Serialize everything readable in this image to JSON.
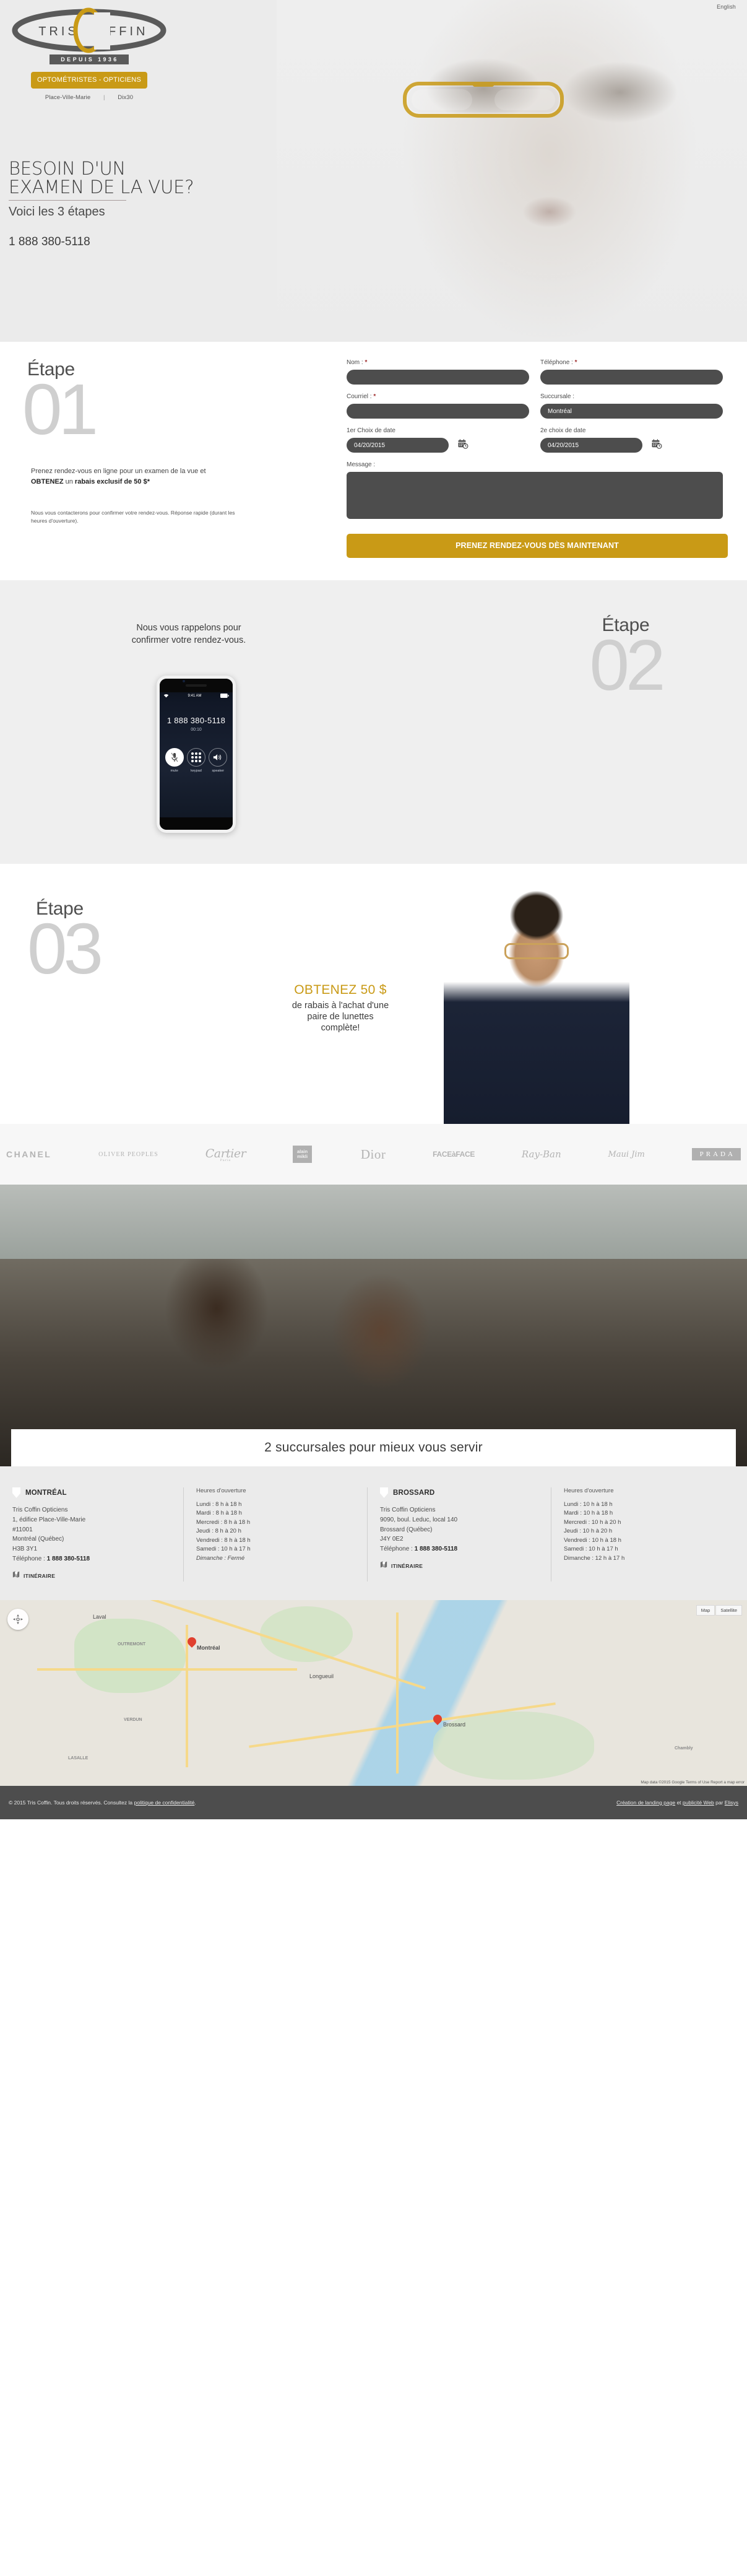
{
  "header": {
    "lang_label": "English",
    "logo": {
      "word_left": "TRIS",
      "word_right": "OFFIN",
      "middle_letter": "C"
    },
    "tagline": "DEPUIS 1936",
    "optom_button": "OPTOMÉTRISTES - OPTICIENS",
    "places": {
      "first": "Place-Ville-Marie",
      "separator": "|",
      "second": "Dix30"
    }
  },
  "hero": {
    "title_line1": "BESOIN D'UN",
    "title_line2": "EXAMEN DE LA VUE?",
    "subtitle": "Voici les 3 étapes",
    "phone": "1 888 380-5118"
  },
  "step1": {
    "word": "Étape",
    "number": "01",
    "blurb_pre": "Prenez rendez-vous en ligne pour un examen de la vue et ",
    "blurb_bold1": "OBTENEZ",
    "blurb_mid": " un ",
    "blurb_bold2": "rabais exclusif de 50 $*",
    "note": "Nous vous contacterons pour confirmer votre rendez-vous. Réponse rapide (durant les heures d'ouverture).",
    "form": {
      "nom_label": "Nom :",
      "nom_value": "",
      "telephone_label": "Téléphone :",
      "telephone_value": "",
      "courriel_label": "Courriel :",
      "courriel_value": "",
      "succursale_label": "Succursale :",
      "succursale_value": "Montréal",
      "date1_label": "1er Choix de date",
      "date1_sup": "er",
      "date1_value": "04/20/2015",
      "date2_label": "2e choix de date",
      "date2_sup": "e",
      "date2_value": "04/20/2015",
      "message_label": "Message :",
      "message_value": "",
      "required_mark": "*",
      "submit_label": "PRENEZ RENDEZ-VOUS DÈS MAINTENANT"
    }
  },
  "step2": {
    "word": "Étape",
    "number": "02",
    "copy_line1": "Nous vous rappelons pour",
    "copy_line2": "confirmer votre rendez-vous.",
    "phone_ui": {
      "status_time": "9:41 AM",
      "number": "1 888 380-5118",
      "timer": "00:10",
      "buttons": [
        "mute",
        "keypad",
        "speaker"
      ]
    }
  },
  "step3": {
    "word": "Étape",
    "number": "03",
    "offer_title": "OBTENEZ 50 $",
    "offer_line1": "de rabais à l'achat d'une",
    "offer_line2": "paire de lunettes",
    "offer_line3": "complète!"
  },
  "brands": [
    {
      "name": "CHANEL",
      "style": "chanel"
    },
    {
      "name": "OLIVER PEOPLES",
      "style": "oliver"
    },
    {
      "name": "Cartier",
      "sub": "Paris",
      "style": "cartier"
    },
    {
      "name": "alain mikli",
      "style": "alain"
    },
    {
      "name": "Dior",
      "style": "dior"
    },
    {
      "name": "FACEàFACE",
      "style": "f2f"
    },
    {
      "name": "Ray-Ban",
      "style": "rayban"
    },
    {
      "name": "Maui Jim",
      "style": "maui"
    },
    {
      "name": "PRADA",
      "style": "prada"
    }
  ],
  "branches_banner": {
    "title": "2 succursales pour mieux vous servir"
  },
  "locations": [
    {
      "name": "MONTRÉAL",
      "company": "Tris Coffin Opticiens",
      "address1": "1, édifice Place-Ville-Marie",
      "address2": "#11001",
      "city": "Montréal (Québec)",
      "postal": "H3B 3Y1",
      "phone_label": "Téléphone : ",
      "phone": "1 888 380-5118",
      "itineraire": "ITINÉRAIRE",
      "hours_title": "Heures d'ouverture",
      "hours": [
        "Lundi : 8 h à 18 h",
        "Mardi : 8 h à 18 h",
        "Mercredi : 8 h à 18 h",
        "Jeudi :  8 h à 20 h",
        "Vendredi : 8 h à 18 h",
        "Samedi : 10 h à 17 h"
      ],
      "hours_closed": "Dimanche : Fermé"
    },
    {
      "name": "BROSSARD",
      "company": "Tris Coffin Opticiens",
      "address1": "9090, boul. Leduc, local 140",
      "address2": "",
      "city": "Brossard (Québec)",
      "postal": "J4Y 0E2",
      "phone_label": "Téléphone : ",
      "phone": "1 888 380-5118",
      "itineraire": "ITINÉRAIRE",
      "hours_title": "Heures d'ouverture",
      "hours": [
        "Lundi : 10 h à 18 h",
        "Mardi : 10 h à 18 h",
        "Mercredi : 10 h à 20 h",
        "Jeudi :  10 h à 20 h",
        "Vendredi : 10 h à 18 h",
        "Samedi : 10 h à 17 h",
        "Dimanche : 12 h à 17 h"
      ],
      "hours_closed": ""
    }
  ],
  "map": {
    "buttons": [
      "Map",
      "Satellite"
    ],
    "labels": [
      "Montréal",
      "Brossard",
      "Longueuil",
      "Laval",
      "OUTREMONT",
      "VERDUN",
      "LASALLE",
      "Chambly"
    ],
    "attribution": "Map data ©2015 Google   Terms of Use   Report a map error"
  },
  "footer": {
    "copyright_pre": "© 2015 Tris Coffin. Tous droits réservés. Consultez la ",
    "privacy_link": "politique de confidentialité",
    "copyright_post": ".",
    "credit_link1": "Création de landing page",
    "credit_mid": " et ",
    "credit_link2": "publicité Web",
    "credit_by": " par ",
    "credit_link3": "Elisys"
  },
  "colors": {
    "accent": "#c99a16",
    "dark_field": "#4d4d4d",
    "required": "#9e2b2b",
    "muted_number": "#cfcfcf"
  }
}
